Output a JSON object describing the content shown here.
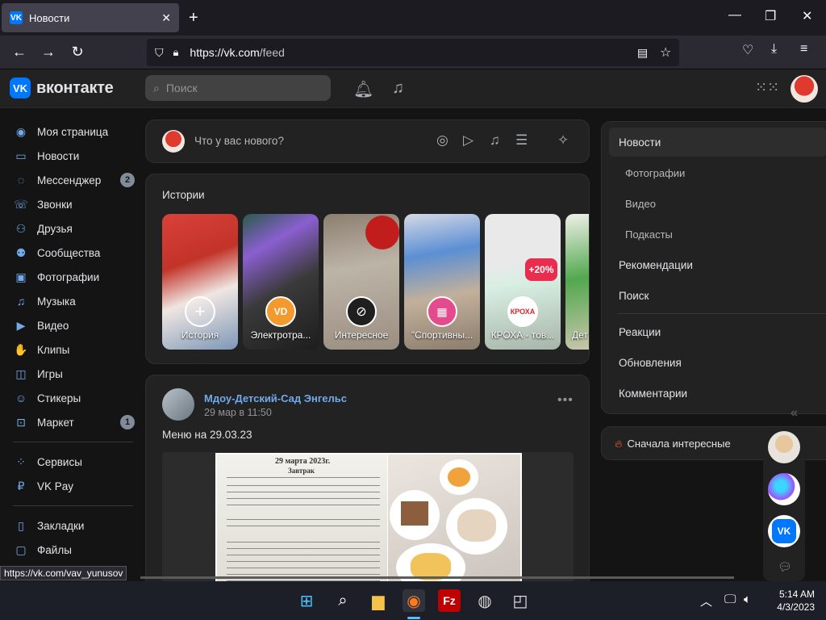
{
  "browser": {
    "tab_title": "Новости",
    "url_host": "https://vk.com",
    "url_path": "/feed",
    "status_link": "https://vk.com/vav_yunusov"
  },
  "header": {
    "logo_text": "вконтакте",
    "search_placeholder": "Поиск"
  },
  "left_nav": {
    "items": [
      {
        "label": "Моя страница",
        "icon": "user-circle-icon"
      },
      {
        "label": "Новости",
        "icon": "newsfeed-icon"
      },
      {
        "label": "Мессенджер",
        "icon": "message-icon",
        "badge": "2"
      },
      {
        "label": "Звонки",
        "icon": "phone-icon"
      },
      {
        "label": "Друзья",
        "icon": "friends-icon"
      },
      {
        "label": "Сообщества",
        "icon": "communities-icon"
      },
      {
        "label": "Фотографии",
        "icon": "photo-icon"
      },
      {
        "label": "Музыка",
        "icon": "music-icon"
      },
      {
        "label": "Видео",
        "icon": "video-icon"
      },
      {
        "label": "Клипы",
        "icon": "clips-icon"
      },
      {
        "label": "Игры",
        "icon": "gamepad-icon"
      },
      {
        "label": "Стикеры",
        "icon": "sticker-icon"
      },
      {
        "label": "Маркет",
        "icon": "market-icon",
        "badge": "1"
      }
    ],
    "items2": [
      {
        "label": "Сервисы",
        "icon": "services-icon"
      },
      {
        "label": "VK Pay",
        "icon": "vkpay-icon"
      }
    ],
    "items3": [
      {
        "label": "Закладки",
        "icon": "bookmark-icon"
      },
      {
        "label": "Файлы",
        "icon": "file-icon"
      }
    ]
  },
  "composer": {
    "placeholder": "Что у вас нового?"
  },
  "stories": {
    "title": "Истории",
    "items": [
      {
        "label": "История"
      },
      {
        "label": "Электротра..."
      },
      {
        "label": "Интересное"
      },
      {
        "label": "\"Спортивны..."
      },
      {
        "label": "КРОХА - тов..."
      },
      {
        "label": "Дет"
      }
    ]
  },
  "post": {
    "author": "Мдоу-Детский-Сад Энгельс",
    "date": "29 мар в 11:50",
    "text": "Меню на 29.03.23",
    "doc_title": "29 марта 2023г.",
    "doc_section": "Завтрак"
  },
  "right_menu": {
    "items": [
      {
        "label": "Новости",
        "active": true
      },
      {
        "label": "Фотографии",
        "sub": true
      },
      {
        "label": "Видео",
        "sub": true
      },
      {
        "label": "Подкасты",
        "sub": true
      },
      {
        "label": "Рекомендации"
      },
      {
        "label": "Поиск"
      },
      {
        "label": "Реакции"
      },
      {
        "label": "Обновления"
      },
      {
        "label": "Комментарии"
      }
    ],
    "sort_label": "Сначала интересные"
  },
  "taskbar": {
    "time": "5:14 AM",
    "date": "4/3/2023"
  },
  "colors": {
    "accent": "#0077ff",
    "link": "#71aaeb",
    "bg": "#141414",
    "card": "#222222"
  }
}
